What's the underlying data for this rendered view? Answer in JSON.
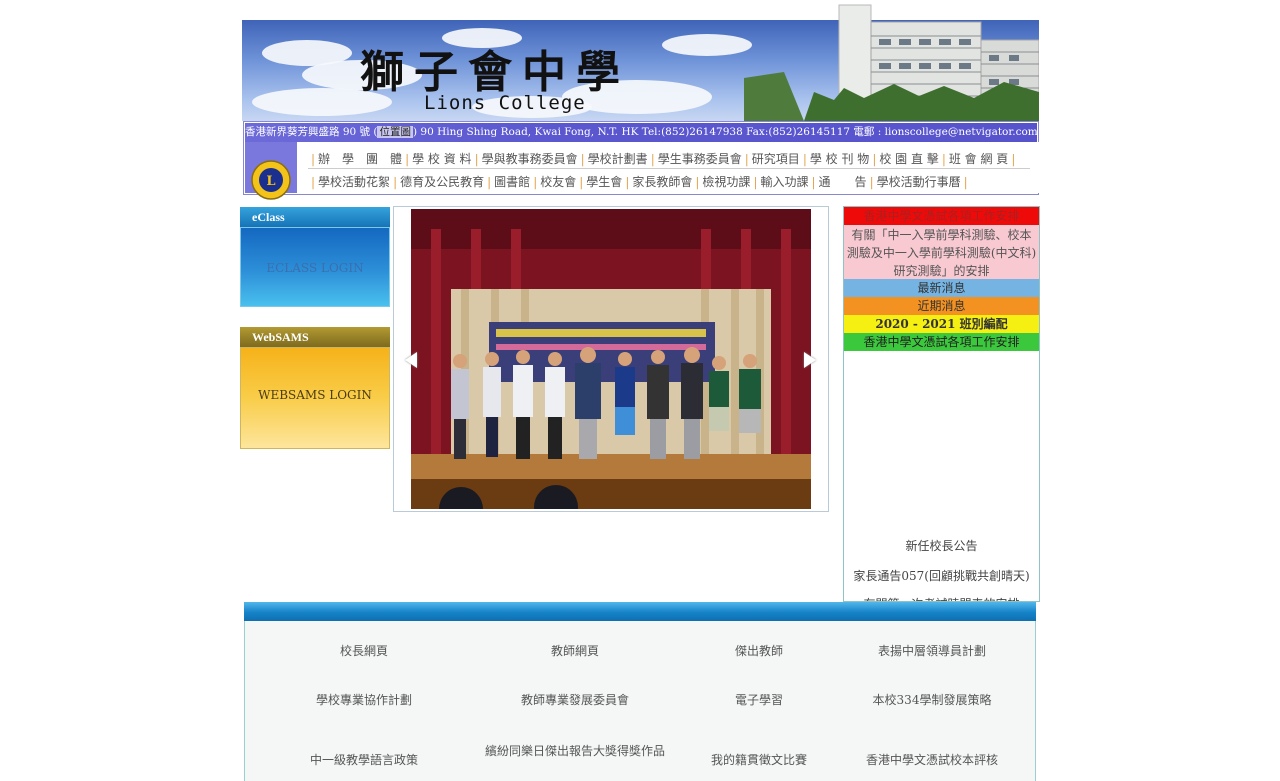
{
  "header": {
    "title": "獅子會中學",
    "subtitle": "Lions College"
  },
  "address_bar": {
    "prefix": "香港新界葵芳興盛路 90 號 (",
    "location_link": "位置圖",
    "suffix": ") 90 Hing Shing Road, Kwai Fong, N.T. HK Tel:(852)26147938 Fax:(852)26145117 電郵 : lionscollege@netvigator.com"
  },
  "nav": {
    "row1": [
      "辦　學　團　體",
      "學 校 資 料",
      "學與教事務委員會",
      "學校計劃書",
      "學生事務委員會",
      "研究項目",
      "學 校 刊 物",
      "校 園 直 擊",
      "班 會 網 頁"
    ],
    "row2": [
      "學校活動花絮",
      "德育及公民教育",
      "圖書館",
      "校友會",
      "學生會",
      "家長教師會",
      "檢視功課",
      "輸入功課",
      "通　　告",
      "學校活動行事曆"
    ]
  },
  "sidebar": {
    "eclass_header": "eClass",
    "eclass_login": "ECLASS LOGIN",
    "websams_header": "WebSAMS",
    "websams_login": "WEBSAMS LOGIN"
  },
  "news": {
    "top_banner": "香港中學文憑試各項工作安排",
    "notice": "有關「中一入學前學科測驗、校本測驗及中一入學前學科測驗(中文科)研究測驗」的安排",
    "latest": "最新消息",
    "recent": "近期消息",
    "classes": "2020 - 2021 班別編配",
    "dse": "香港中學文憑試各項工作安排",
    "links": [
      "新任校長公告",
      "家長通告057(回顧挑戰共創晴天)",
      "有關第一次考試時間表的安排"
    ]
  },
  "links": {
    "row1": [
      "校長網頁",
      "教師網頁",
      "傑出教師",
      "表揚中層領導員計劃"
    ],
    "row2": [
      "學校專業協作計劃",
      "教師專業發展委員會",
      "電子學習",
      "本校334學制發展策略"
    ],
    "row3": [
      "中一級教學語言政策",
      "繽紛同樂日傑出報告大獎得獎作品",
      "我的籍貫徵文比賽",
      "香港中學文憑試校本評核"
    ]
  },
  "colors": {
    "accent_blue": "#1583c8",
    "nav_separator": "#e3a24a",
    "news_red": "#ef0a0a",
    "news_orange": "#f39121",
    "news_yellow": "#f5f012",
    "news_green": "#3cc83c"
  },
  "icons": {
    "logo": "lions-logo-icon",
    "slide_prev": "chevron-left-icon",
    "slide_next": "chevron-right-icon"
  }
}
